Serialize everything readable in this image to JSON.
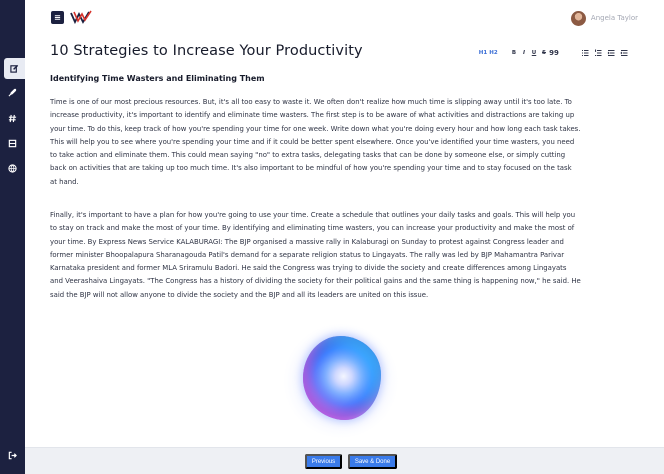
{
  "sidebar": {
    "items": [
      {
        "icon": "edit-icon",
        "active": true
      },
      {
        "icon": "rocket-icon",
        "active": false
      },
      {
        "icon": "hash-icon",
        "active": false
      },
      {
        "icon": "book-icon",
        "active": false
      },
      {
        "icon": "globe-icon",
        "active": false
      }
    ],
    "logout_icon": "logout-icon"
  },
  "header": {
    "menu_icon": "menu-icon",
    "logo": "brand-logo-icon",
    "user_name": "Angela Taylor"
  },
  "editor": {
    "title": "10 Strategies to Increase Your Productivity",
    "toolbar": {
      "h1": "H1",
      "h2": "H2",
      "bold": "B",
      "italic": "I",
      "underline": "U",
      "strike": "S",
      "quote": "99"
    },
    "subtitle": "Identifying Time Wasters and Eliminating Them",
    "paragraph1": [
      "Time is one of our most precious resources. But, it's all too easy to waste it. We often don't realize how much time is slipping away until it's too late. To",
      "increase productivity, it's important to identify and eliminate time wasters. The first step is to be aware of what activities and distractions are taking up",
      "your time. To do this, keep track of how you're spending your time for one week. Write down what you're doing every hour and how long each task takes.",
      "This will help you to see where you're spending your time and if it could be better spent elsewhere. Once you've identified your time wasters, you need",
      "to take action and eliminate them. This could mean saying \"no\" to extra tasks, delegating tasks that can be done by someone else, or simply cutting",
      "back on activities that are taking up too much time. It's also important to be mindful of how you're spending your time and to stay focused on the task",
      "at hand."
    ],
    "paragraph2": [
      "Finally, it's important to have a plan for how you're going to use your time. Create a schedule that outlines your daily tasks and goals. This will help you",
      "to stay on track and make the most of your time. By identifying and eliminating time wasters, you can increase your productivity and make the most of",
      "your time. By Express News Service KALABURAGI: The BJP organised a massive rally in Kalaburagi on Sunday to protest against Congress leader and",
      "former minister Bhoopalapura Sharanagouda Patil's demand for a separate religion status to Lingayats. The rally was led by BJP Mahamantra Parivar",
      "Karnataka president and former MLA Sriramulu Badori. He said the Congress was trying to divide the society and create differences among Lingayats",
      "and Veerashaiva Lingayats. \"The Congress has a history of dividing the society for their political gains and the same thing is happening now,\" he said. He",
      "said the BJP will not allow anyone to divide the society and the BJP and all its leaders are united on this issue."
    ]
  },
  "footer": {
    "previous_label": "Previous",
    "save_label": "Save & Done"
  },
  "colors": {
    "sidebar": "#1c2140",
    "accent": "#3a7bea",
    "logo_red": "#d8342c"
  }
}
